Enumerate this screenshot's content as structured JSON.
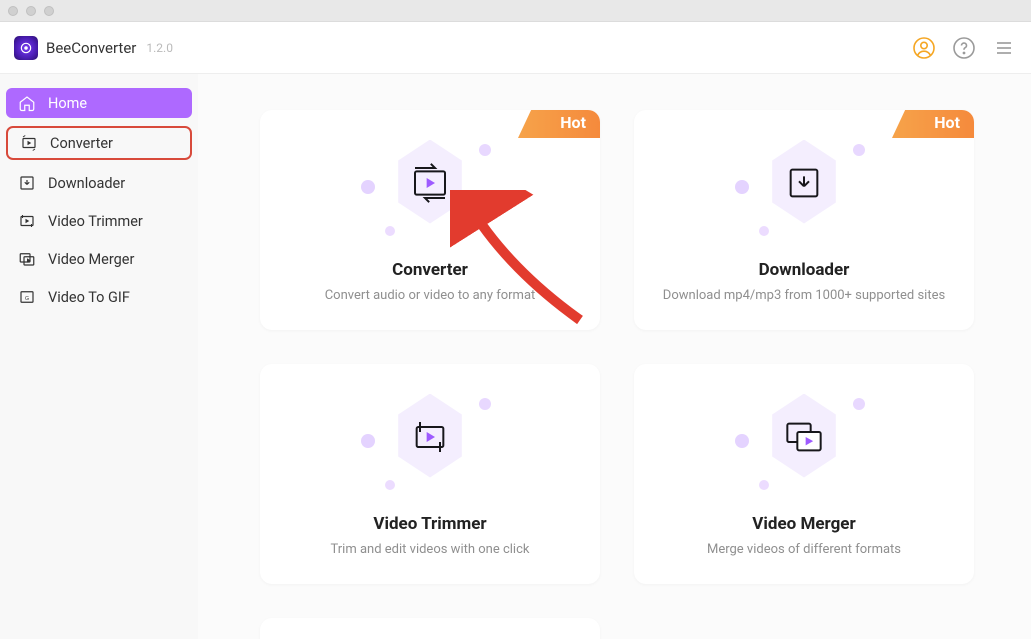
{
  "app": {
    "name": "BeeConverter",
    "version": "1.2.0"
  },
  "sidebar": {
    "items": [
      {
        "label": "Home"
      },
      {
        "label": "Converter"
      },
      {
        "label": "Downloader"
      },
      {
        "label": "Video Trimmer"
      },
      {
        "label": "Video Merger"
      },
      {
        "label": "Video To GIF"
      }
    ]
  },
  "cards": [
    {
      "title": "Converter",
      "desc": "Convert audio or video to any format",
      "hot": "Hot"
    },
    {
      "title": "Downloader",
      "desc": "Download mp4/mp3 from 1000+ supported sites",
      "hot": "Hot"
    },
    {
      "title": "Video Trimmer",
      "desc": "Trim and edit videos with one click"
    },
    {
      "title": "Video Merger",
      "desc": "Merge videos of different formats"
    }
  ]
}
